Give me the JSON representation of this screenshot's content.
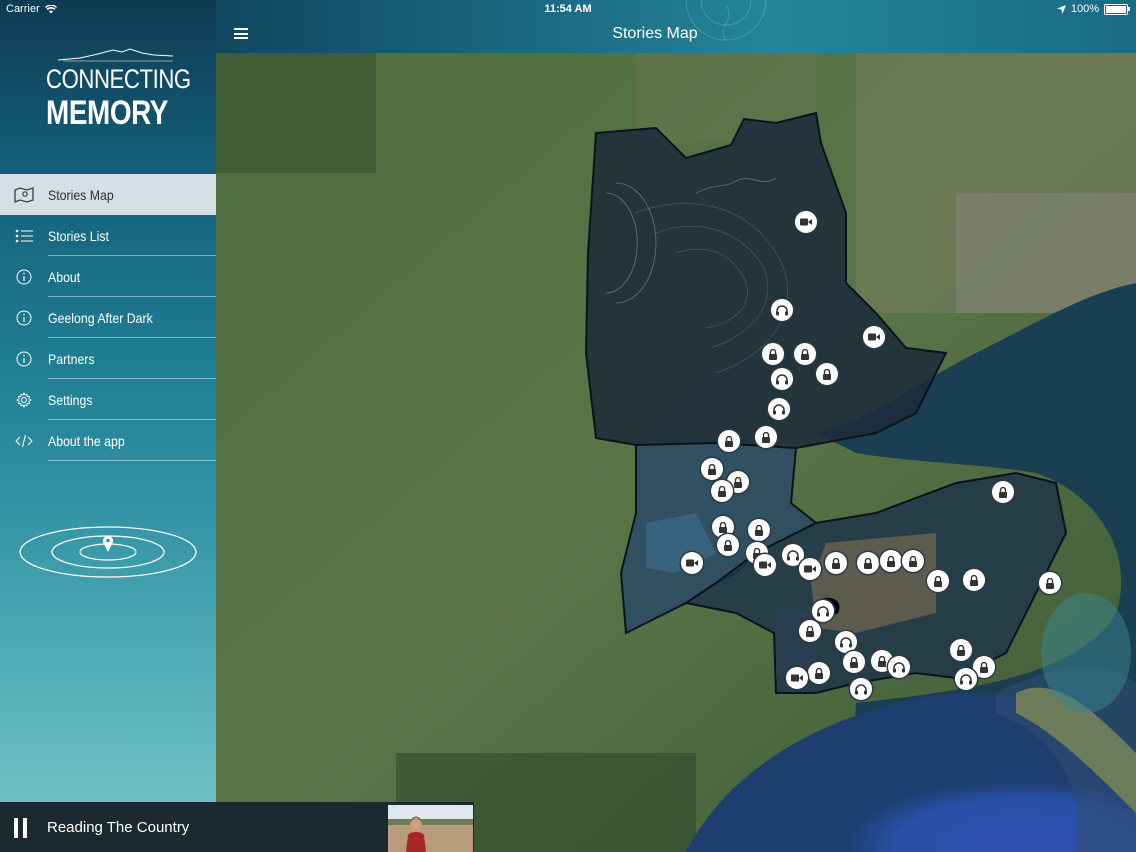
{
  "status_bar": {
    "carrier": "Carrier",
    "time": "11:54 AM",
    "battery": "100%"
  },
  "logo": {
    "line1": "CONNECTING",
    "line2": "MEMORY"
  },
  "sidebar": {
    "items": [
      {
        "label": "Stories Map",
        "icon": "map-icon",
        "active": true
      },
      {
        "label": "Stories List",
        "icon": "list-icon",
        "active": false
      },
      {
        "label": "About",
        "icon": "info-icon",
        "active": false
      },
      {
        "label": "Geelong After Dark",
        "icon": "info-icon",
        "active": false
      },
      {
        "label": "Partners",
        "icon": "info-icon",
        "active": false
      },
      {
        "label": "Settings",
        "icon": "gear-icon",
        "active": false
      },
      {
        "label": "About the app",
        "icon": "code-icon",
        "active": false
      }
    ]
  },
  "header": {
    "title": "Stories Map",
    "menu_icon": "hamburger-icon"
  },
  "player": {
    "track_title": "Reading The Country",
    "state_icon": "pause-icon"
  },
  "map": {
    "marker_types": [
      "lock-icon",
      "headphones-icon",
      "video-icon"
    ]
  }
}
